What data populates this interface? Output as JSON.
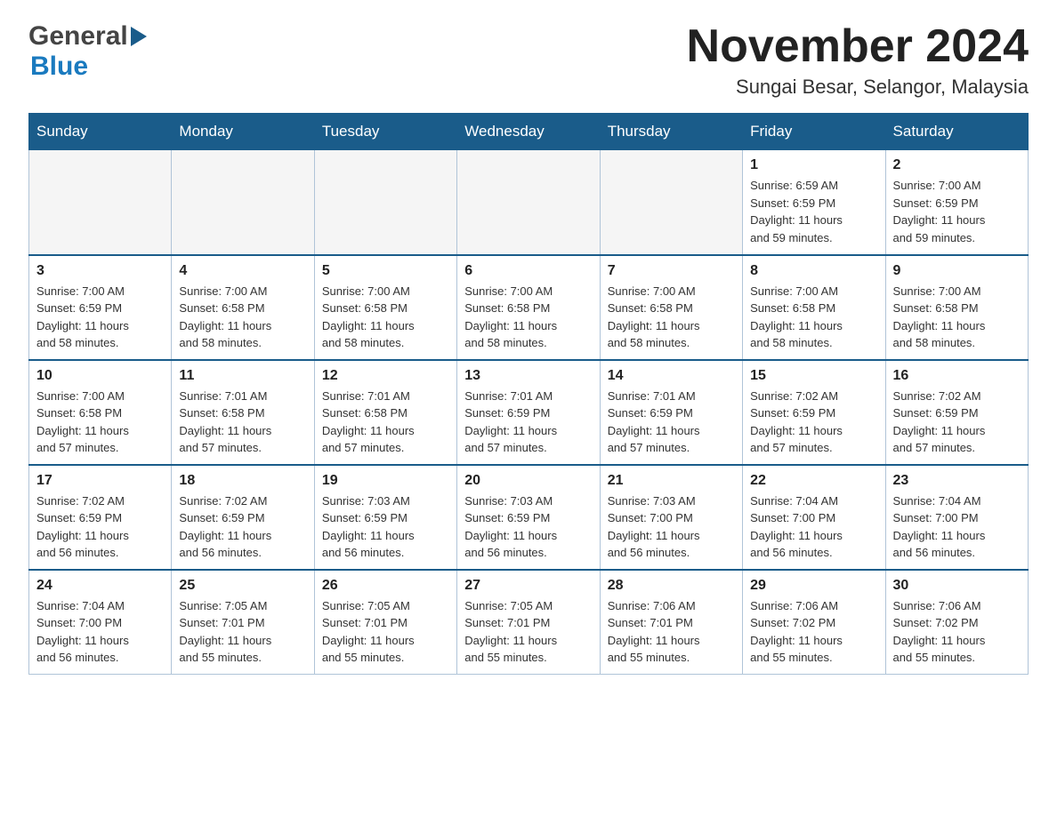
{
  "header": {
    "logo_general": "General",
    "logo_blue": "Blue",
    "main_title": "November 2024",
    "subtitle": "Sungai Besar, Selangor, Malaysia"
  },
  "calendar": {
    "days_of_week": [
      "Sunday",
      "Monday",
      "Tuesday",
      "Wednesday",
      "Thursday",
      "Friday",
      "Saturday"
    ],
    "weeks": [
      {
        "days": [
          {
            "num": "",
            "info": ""
          },
          {
            "num": "",
            "info": ""
          },
          {
            "num": "",
            "info": ""
          },
          {
            "num": "",
            "info": ""
          },
          {
            "num": "",
            "info": ""
          },
          {
            "num": "1",
            "info": "Sunrise: 6:59 AM\nSunset: 6:59 PM\nDaylight: 11 hours\nand 59 minutes."
          },
          {
            "num": "2",
            "info": "Sunrise: 7:00 AM\nSunset: 6:59 PM\nDaylight: 11 hours\nand 59 minutes."
          }
        ]
      },
      {
        "days": [
          {
            "num": "3",
            "info": "Sunrise: 7:00 AM\nSunset: 6:59 PM\nDaylight: 11 hours\nand 58 minutes."
          },
          {
            "num": "4",
            "info": "Sunrise: 7:00 AM\nSunset: 6:58 PM\nDaylight: 11 hours\nand 58 minutes."
          },
          {
            "num": "5",
            "info": "Sunrise: 7:00 AM\nSunset: 6:58 PM\nDaylight: 11 hours\nand 58 minutes."
          },
          {
            "num": "6",
            "info": "Sunrise: 7:00 AM\nSunset: 6:58 PM\nDaylight: 11 hours\nand 58 minutes."
          },
          {
            "num": "7",
            "info": "Sunrise: 7:00 AM\nSunset: 6:58 PM\nDaylight: 11 hours\nand 58 minutes."
          },
          {
            "num": "8",
            "info": "Sunrise: 7:00 AM\nSunset: 6:58 PM\nDaylight: 11 hours\nand 58 minutes."
          },
          {
            "num": "9",
            "info": "Sunrise: 7:00 AM\nSunset: 6:58 PM\nDaylight: 11 hours\nand 58 minutes."
          }
        ]
      },
      {
        "days": [
          {
            "num": "10",
            "info": "Sunrise: 7:00 AM\nSunset: 6:58 PM\nDaylight: 11 hours\nand 57 minutes."
          },
          {
            "num": "11",
            "info": "Sunrise: 7:01 AM\nSunset: 6:58 PM\nDaylight: 11 hours\nand 57 minutes."
          },
          {
            "num": "12",
            "info": "Sunrise: 7:01 AM\nSunset: 6:58 PM\nDaylight: 11 hours\nand 57 minutes."
          },
          {
            "num": "13",
            "info": "Sunrise: 7:01 AM\nSunset: 6:59 PM\nDaylight: 11 hours\nand 57 minutes."
          },
          {
            "num": "14",
            "info": "Sunrise: 7:01 AM\nSunset: 6:59 PM\nDaylight: 11 hours\nand 57 minutes."
          },
          {
            "num": "15",
            "info": "Sunrise: 7:02 AM\nSunset: 6:59 PM\nDaylight: 11 hours\nand 57 minutes."
          },
          {
            "num": "16",
            "info": "Sunrise: 7:02 AM\nSunset: 6:59 PM\nDaylight: 11 hours\nand 57 minutes."
          }
        ]
      },
      {
        "days": [
          {
            "num": "17",
            "info": "Sunrise: 7:02 AM\nSunset: 6:59 PM\nDaylight: 11 hours\nand 56 minutes."
          },
          {
            "num": "18",
            "info": "Sunrise: 7:02 AM\nSunset: 6:59 PM\nDaylight: 11 hours\nand 56 minutes."
          },
          {
            "num": "19",
            "info": "Sunrise: 7:03 AM\nSunset: 6:59 PM\nDaylight: 11 hours\nand 56 minutes."
          },
          {
            "num": "20",
            "info": "Sunrise: 7:03 AM\nSunset: 6:59 PM\nDaylight: 11 hours\nand 56 minutes."
          },
          {
            "num": "21",
            "info": "Sunrise: 7:03 AM\nSunset: 7:00 PM\nDaylight: 11 hours\nand 56 minutes."
          },
          {
            "num": "22",
            "info": "Sunrise: 7:04 AM\nSunset: 7:00 PM\nDaylight: 11 hours\nand 56 minutes."
          },
          {
            "num": "23",
            "info": "Sunrise: 7:04 AM\nSunset: 7:00 PM\nDaylight: 11 hours\nand 56 minutes."
          }
        ]
      },
      {
        "days": [
          {
            "num": "24",
            "info": "Sunrise: 7:04 AM\nSunset: 7:00 PM\nDaylight: 11 hours\nand 56 minutes."
          },
          {
            "num": "25",
            "info": "Sunrise: 7:05 AM\nSunset: 7:01 PM\nDaylight: 11 hours\nand 55 minutes."
          },
          {
            "num": "26",
            "info": "Sunrise: 7:05 AM\nSunset: 7:01 PM\nDaylight: 11 hours\nand 55 minutes."
          },
          {
            "num": "27",
            "info": "Sunrise: 7:05 AM\nSunset: 7:01 PM\nDaylight: 11 hours\nand 55 minutes."
          },
          {
            "num": "28",
            "info": "Sunrise: 7:06 AM\nSunset: 7:01 PM\nDaylight: 11 hours\nand 55 minutes."
          },
          {
            "num": "29",
            "info": "Sunrise: 7:06 AM\nSunset: 7:02 PM\nDaylight: 11 hours\nand 55 minutes."
          },
          {
            "num": "30",
            "info": "Sunrise: 7:06 AM\nSunset: 7:02 PM\nDaylight: 11 hours\nand 55 minutes."
          }
        ]
      }
    ]
  }
}
